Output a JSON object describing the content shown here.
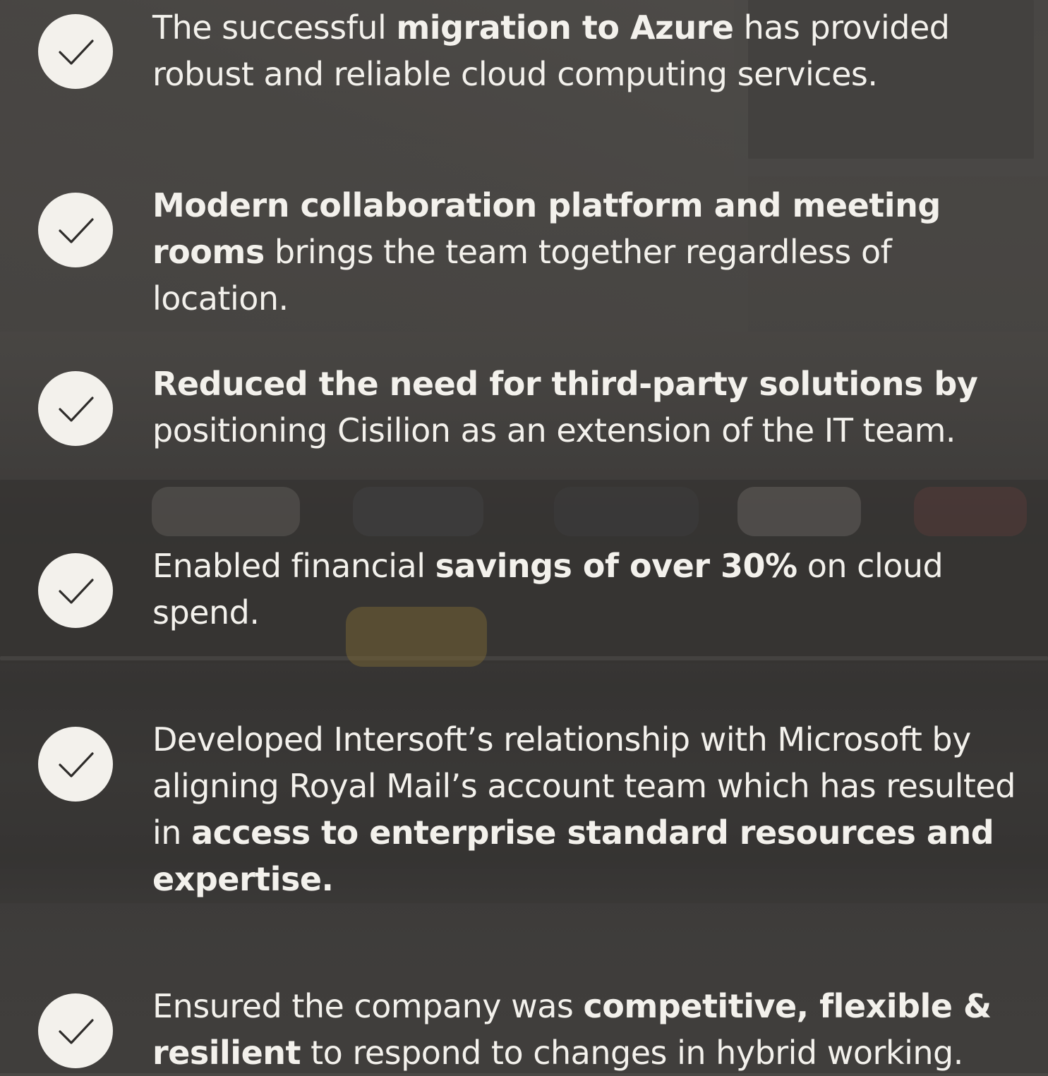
{
  "items": [
    {
      "segments": [
        {
          "text": "The successful ",
          "bold": false
        },
        {
          "text": "migration to Azure",
          "bold": true
        },
        {
          "text": " has provided robust and reliable cloud computing services.",
          "bold": false
        }
      ]
    },
    {
      "segments": [
        {
          "text": "Modern collaboration platform and meeting rooms",
          "bold": true
        },
        {
          "text": " brings the team together regardless of location.",
          "bold": false
        }
      ]
    },
    {
      "segments": [
        {
          "text": "Reduced the need for third-party solutions by",
          "bold": true
        },
        {
          "text": " positioning Cisilion as an extension of the IT team.",
          "bold": false
        }
      ]
    },
    {
      "segments": [
        {
          "text": "Enabled financial ",
          "bold": false
        },
        {
          "text": "savings of over 30%",
          "bold": true
        },
        {
          "text": " on cloud spend.",
          "bold": false
        }
      ]
    },
    {
      "segments": [
        {
          "text": "Developed Intersoft’s relationship with Microsoft by aligning Royal Mail’s account team which has resulted in ",
          "bold": false
        },
        {
          "text": "access to enterprise standard resources and expertise.",
          "bold": true
        }
      ]
    },
    {
      "segments": [
        {
          "text": "Ensured the company was ",
          "bold": false
        },
        {
          "text": "competitive, flexible & resilient",
          "bold": true
        },
        {
          "text": " to respond to changes in hybrid working.",
          "bold": false
        }
      ]
    }
  ],
  "icon": "checkmark-icon",
  "colors": {
    "text": "#f3f1ec",
    "check_bg": "#f3f1ec",
    "check_stroke": "#2e2c2a"
  }
}
